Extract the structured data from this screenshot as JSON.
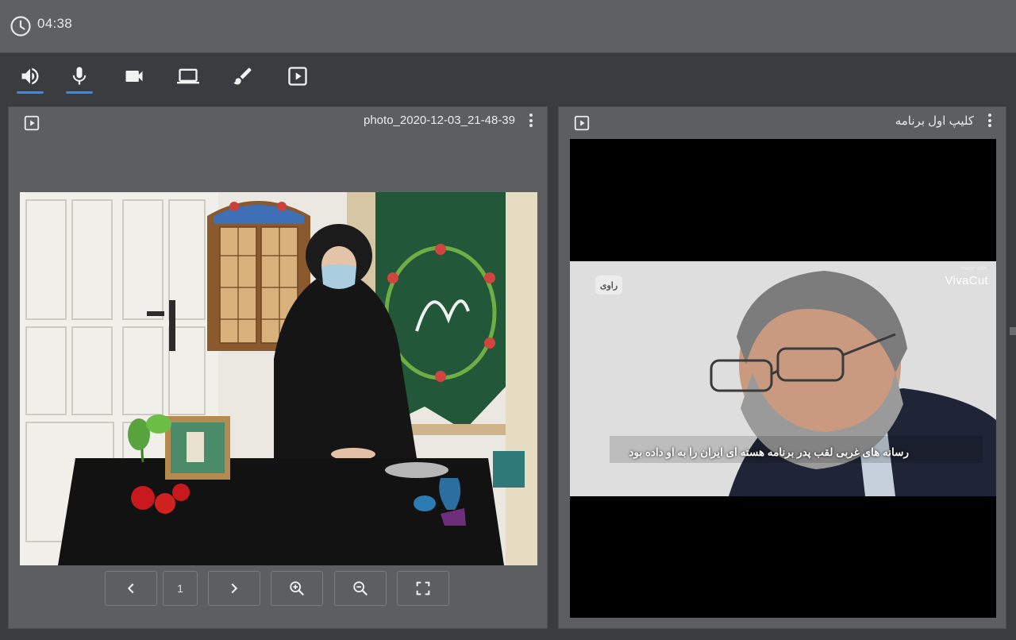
{
  "header": {
    "clock_icon": "clock-icon",
    "time": "04:38"
  },
  "toolbar": {
    "items": [
      {
        "name": "speaker",
        "icon": "speaker-icon",
        "active": true
      },
      {
        "name": "microphone",
        "icon": "microphone-icon",
        "active": true
      },
      {
        "name": "camera",
        "icon": "video-camera-icon",
        "active": false
      },
      {
        "name": "screen-share",
        "icon": "laptop-icon",
        "active": false
      },
      {
        "name": "whiteboard",
        "icon": "brush-icon",
        "active": false
      },
      {
        "name": "media-player",
        "icon": "play-box-icon",
        "active": false
      }
    ],
    "accent": "#2f8ef4"
  },
  "left_panel": {
    "title": "photo_2020-12-03_21-48-39",
    "play_icon": "play-box-icon",
    "menu_icon": "kebab-menu-icon",
    "pager": {
      "prev_icon": "chevron-left-icon",
      "page": "1",
      "next_icon": "chevron-right-icon",
      "zoom_in_icon": "zoom-in-icon",
      "zoom_out_icon": "zoom-out-icon",
      "fullscreen_icon": "fullscreen-icon"
    }
  },
  "right_panel": {
    "title": "کلیپ اول برنامه",
    "play_icon": "play-box-icon",
    "menu_icon": "kebab-menu-icon",
    "video": {
      "watermark": "VivaCut",
      "logo": "راوی",
      "caption": "رسانه های غربی لقب پدر برنامه هسته ای ایران را به او داده بود"
    }
  }
}
